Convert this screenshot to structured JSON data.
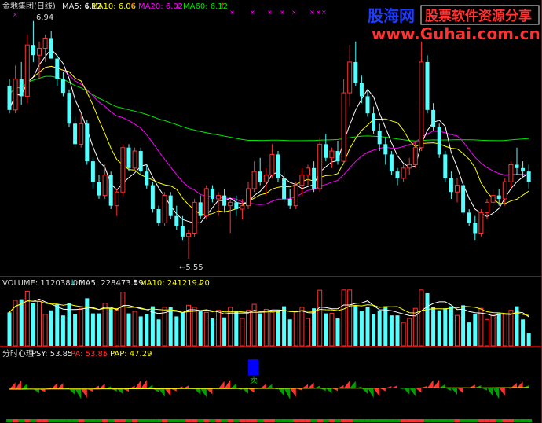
{
  "header": {
    "name": "金地集团(日线)",
    "ma5": "MA5: 6.12",
    "ma10": "MA10: 6.06",
    "ma20": "MA20: 6.02",
    "ma60": "MA60: 6.12"
  },
  "watermark": {
    "brand": "股海网",
    "slogan": "股票软件资源分享",
    "url": "www.Guhai.com.cn"
  },
  "annotations": {
    "high": "6.94",
    "low": "←5.55"
  },
  "volume_panel": {
    "label": "VOLUME: 112038.00",
    "ma5": "MA5: 228473.59",
    "ma10": "MA10: 241219.20"
  },
  "psy_panel": {
    "title": "分时心理",
    "psy": "PSY: 53.85",
    "pa": "PA: 53.85",
    "pap": "PAP: 47.29",
    "marker": "卖"
  },
  "colors": {
    "up": "#ff3232",
    "down": "#54ffff",
    "ma5": "#ffffff",
    "ma10": "#ffff00",
    "ma20": "#ff00ff",
    "ma60": "#00e600",
    "panel_border": "#b00000"
  },
  "chart_data": {
    "type": "candlestick",
    "title": "金地集团(日线)",
    "price_range": [
      5.5,
      6.98
    ],
    "series": [
      {
        "name": "MA5",
        "last": 6.12
      },
      {
        "name": "MA10",
        "last": 6.06
      },
      {
        "name": "MA20",
        "last": 6.02
      },
      {
        "name": "MA60",
        "last": 6.12
      }
    ],
    "candles_ohlc": [
      [
        6.56,
        6.6,
        6.4,
        6.42
      ],
      [
        6.42,
        6.68,
        6.4,
        6.6
      ],
      [
        6.6,
        6.7,
        6.45,
        6.5
      ],
      [
        6.5,
        6.86,
        6.46,
        6.8
      ],
      [
        6.8,
        6.94,
        6.7,
        6.74
      ],
      [
        6.74,
        6.82,
        6.6,
        6.78
      ],
      [
        6.78,
        6.86,
        6.7,
        6.84
      ],
      [
        6.84,
        6.88,
        6.72,
        6.72
      ],
      [
        6.72,
        6.74,
        6.56,
        6.6
      ],
      [
        6.6,
        6.64,
        6.5,
        6.52
      ],
      [
        6.52,
        6.54,
        6.32,
        6.34
      ],
      [
        6.34,
        6.38,
        6.2,
        6.22
      ],
      [
        6.22,
        6.4,
        6.2,
        6.34
      ],
      [
        6.34,
        6.36,
        6.1,
        6.12
      ],
      [
        6.12,
        6.14,
        5.96,
        6.0
      ],
      [
        6.0,
        6.04,
        5.9,
        5.92
      ],
      [
        5.92,
        6.1,
        5.9,
        6.04
      ],
      [
        6.04,
        6.06,
        5.84,
        5.86
      ],
      [
        5.86,
        5.96,
        5.8,
        5.94
      ],
      [
        5.94,
        6.22,
        5.92,
        6.2
      ],
      [
        6.2,
        6.22,
        6.06,
        6.08
      ],
      [
        6.08,
        6.2,
        6.06,
        6.18
      ],
      [
        6.18,
        6.2,
        6.04,
        6.06
      ],
      [
        6.06,
        6.1,
        5.96,
        5.98
      ],
      [
        5.98,
        6.0,
        5.82,
        5.84
      ],
      [
        5.84,
        5.86,
        5.74,
        5.76
      ],
      [
        5.76,
        5.94,
        5.74,
        5.92
      ],
      [
        5.92,
        5.94,
        5.78,
        5.8
      ],
      [
        5.8,
        5.86,
        5.72,
        5.74
      ],
      [
        5.74,
        5.8,
        5.66,
        5.68
      ],
      [
        5.68,
        5.72,
        5.55,
        5.7
      ],
      [
        5.7,
        5.9,
        5.68,
        5.88
      ],
      [
        5.88,
        5.92,
        5.78,
        5.8
      ],
      [
        5.8,
        5.98,
        5.78,
        5.96
      ],
      [
        5.96,
        5.98,
        5.88,
        5.9
      ],
      [
        5.9,
        5.94,
        5.8,
        5.92
      ],
      [
        5.92,
        5.96,
        5.82,
        5.86
      ],
      [
        5.86,
        5.9,
        5.7,
        5.88
      ],
      [
        5.88,
        5.92,
        5.8,
        5.84
      ],
      [
        5.84,
        5.9,
        5.78,
        5.86
      ],
      [
        5.86,
        6.0,
        5.84,
        5.96
      ],
      [
        5.96,
        6.12,
        5.94,
        6.06
      ],
      [
        6.06,
        6.14,
        5.98,
        6.0
      ],
      [
        6.0,
        6.08,
        5.92,
        6.04
      ],
      [
        6.04,
        6.22,
        6.02,
        6.16
      ],
      [
        6.16,
        6.18,
        6.0,
        6.02
      ],
      [
        6.02,
        6.06,
        5.88,
        5.9
      ],
      [
        5.9,
        5.96,
        5.84,
        5.86
      ],
      [
        5.86,
        6.0,
        5.84,
        5.98
      ],
      [
        5.98,
        6.08,
        5.92,
        6.04
      ],
      [
        6.04,
        6.1,
        5.98,
        6.08
      ],
      [
        6.08,
        6.12,
        5.94,
        5.96
      ],
      [
        5.96,
        6.26,
        5.94,
        6.22
      ],
      [
        6.22,
        6.28,
        6.12,
        6.14
      ],
      [
        6.14,
        6.2,
        6.08,
        6.18
      ],
      [
        6.18,
        6.24,
        6.1,
        6.12
      ],
      [
        6.12,
        6.6,
        6.1,
        6.52
      ],
      [
        6.52,
        6.8,
        6.44,
        6.7
      ],
      [
        6.7,
        6.82,
        6.56,
        6.58
      ],
      [
        6.58,
        6.62,
        6.46,
        6.5
      ],
      [
        6.5,
        6.54,
        6.38,
        6.4
      ],
      [
        6.4,
        6.44,
        6.28,
        6.3
      ],
      [
        6.3,
        6.34,
        6.18,
        6.22
      ],
      [
        6.22,
        6.26,
        6.1,
        6.16
      ],
      [
        6.16,
        6.18,
        6.04,
        6.06
      ],
      [
        6.06,
        6.08,
        5.98,
        6.02
      ],
      [
        6.02,
        6.1,
        6.0,
        6.08
      ],
      [
        6.08,
        6.14,
        6.04,
        6.1
      ],
      [
        6.1,
        6.24,
        6.08,
        6.2
      ],
      [
        6.2,
        6.82,
        6.18,
        6.7
      ],
      [
        6.7,
        6.74,
        6.4,
        6.42
      ],
      [
        6.42,
        6.46,
        6.3,
        6.32
      ],
      [
        6.32,
        6.34,
        6.14,
        6.16
      ],
      [
        6.16,
        6.18,
        6.0,
        6.02
      ],
      [
        6.02,
        6.06,
        5.9,
        5.94
      ],
      [
        5.94,
        6.02,
        5.88,
        5.98
      ],
      [
        5.98,
        6.0,
        5.8,
        5.82
      ],
      [
        5.82,
        5.84,
        5.74,
        5.76
      ],
      [
        5.76,
        5.8,
        5.66,
        5.7
      ],
      [
        5.7,
        5.84,
        5.68,
        5.82
      ],
      [
        5.82,
        5.9,
        5.78,
        5.88
      ],
      [
        5.88,
        5.96,
        5.84,
        5.92
      ],
      [
        5.92,
        5.96,
        5.86,
        5.9
      ],
      [
        5.9,
        6.02,
        5.86,
        6.0
      ],
      [
        6.0,
        6.12,
        5.96,
        6.1
      ],
      [
        6.1,
        6.2,
        6.04,
        6.08
      ],
      [
        6.08,
        6.12,
        6.02,
        6.06
      ],
      [
        6.06,
        6.1,
        5.96,
        6.0
      ]
    ],
    "volume_range": [
      0,
      520000
    ],
    "volume_last": 112038,
    "psy": 53.85,
    "pa": 53.85,
    "pap": 47.29
  }
}
